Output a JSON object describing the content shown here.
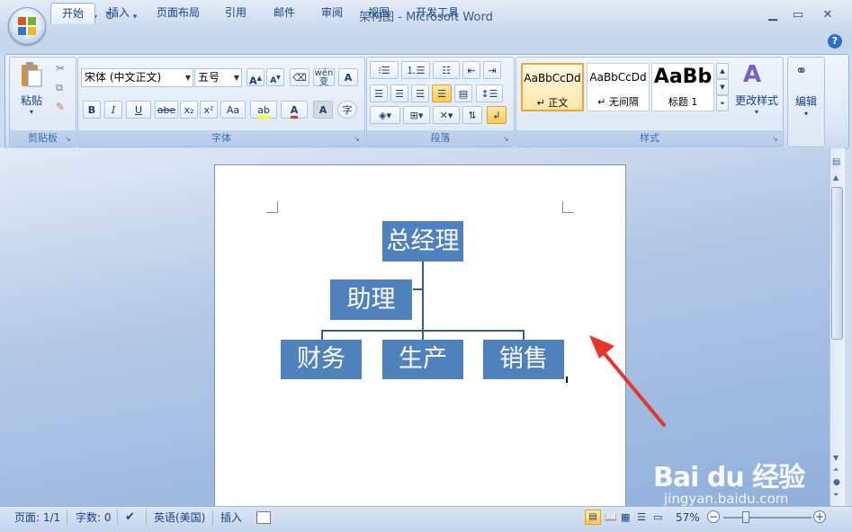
{
  "window": {
    "title": "架构图 - Microsoft Word"
  },
  "tabs": [
    "开始",
    "插入",
    "页面布局",
    "引用",
    "邮件",
    "审阅",
    "视图",
    "开发工具"
  ],
  "active_tab": "开始",
  "ribbon": {
    "clipboard": {
      "paste_label": "粘贴",
      "group_label": "剪贴板"
    },
    "font": {
      "font_name": "宋体 (中文正文)",
      "font_size": "五号",
      "group_label": "字体",
      "format_buttons": [
        "B",
        "I",
        "U",
        "abe",
        "x₂",
        "x²",
        "Aa"
      ],
      "wen_label": "wén 变",
      "a_box": "A",
      "zi": "字"
    },
    "paragraph": {
      "group_label": "段落"
    },
    "styles": {
      "group_label": "样式",
      "cards": [
        {
          "sample": "AaBbCcDd",
          "name": "↵ 正文",
          "selected": true
        },
        {
          "sample": "AaBbCcDd",
          "name": "↵ 无间隔",
          "selected": false
        },
        {
          "sample": "AaBb",
          "name": "标题 1",
          "selected": false
        }
      ],
      "change_styles_label": "更改样式"
    },
    "editing": {
      "label": "编辑"
    }
  },
  "org_chart": {
    "top": "总经理",
    "assistant": "助理",
    "children": [
      "财务",
      "生产",
      "销售"
    ]
  },
  "status": {
    "page": "页面: 1/1",
    "words": "字数: 0",
    "language": "英语(美国)",
    "mode": "插入",
    "zoom": "57%"
  },
  "watermark": {
    "brand": "Bai du 经验",
    "url": "jingyan.baidu.com"
  },
  "colors": {
    "node_fill": "#4f81bd",
    "connector": "#385d8a",
    "arrow": "#e8342a"
  }
}
